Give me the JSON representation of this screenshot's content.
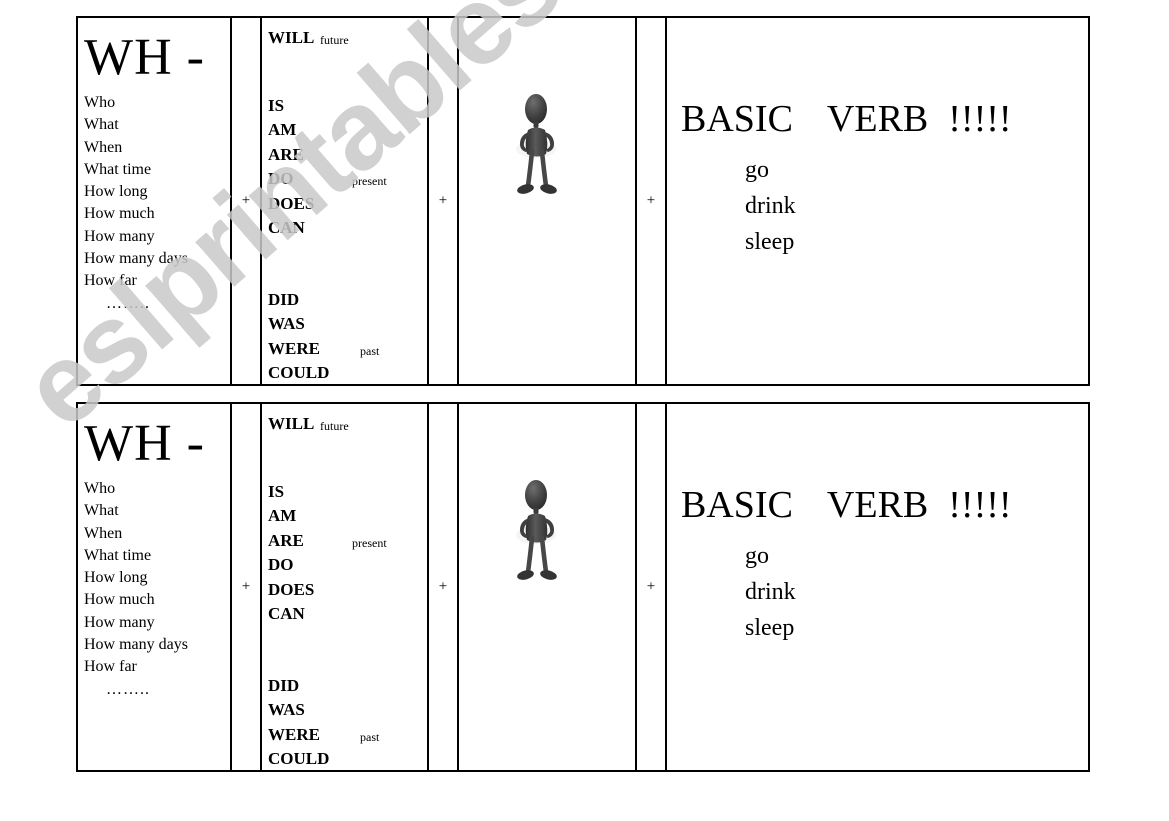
{
  "page": {
    "watermark": "eslprintables.com",
    "watermark_color": "#c9c9c9",
    "background_color": "#ffffff",
    "border_color": "#000000"
  },
  "separator": {
    "plus": "+"
  },
  "wh": {
    "title": "WH -",
    "items": [
      "Who",
      "What",
      "When",
      "What time",
      "How long",
      "How much",
      "How many",
      "How many days",
      "How far"
    ],
    "ellipsis": "…….."
  },
  "aux": {
    "future": {
      "words": [
        "WILL"
      ],
      "tag": "future"
    },
    "present": {
      "words": [
        "IS",
        "AM",
        "ARE",
        "DO",
        "DOES",
        "CAN"
      ],
      "tag": "present",
      "tag_row_table1": 3,
      "tag_row_table2": 2
    },
    "past": {
      "words": [
        "DID",
        "WAS",
        "WERE",
        "COULD"
      ],
      "tag": "past",
      "tag_row": 2
    }
  },
  "figure": {
    "name": "stick-figure-character",
    "description": "dark grey 3D human figure standing with hands at waist",
    "body_color": "#3d3d3d",
    "shadow_color": "#8a8a8a"
  },
  "verb": {
    "headline_word_1": "BASIC",
    "headline_word_2": "VERB",
    "headline_marks": "!!!!!",
    "examples": [
      "go",
      "drink",
      "sleep"
    ]
  },
  "tables": [
    {
      "id": "sheet-1",
      "label": "worksheet-row-1"
    },
    {
      "id": "sheet-2",
      "label": "worksheet-row-2"
    }
  ]
}
